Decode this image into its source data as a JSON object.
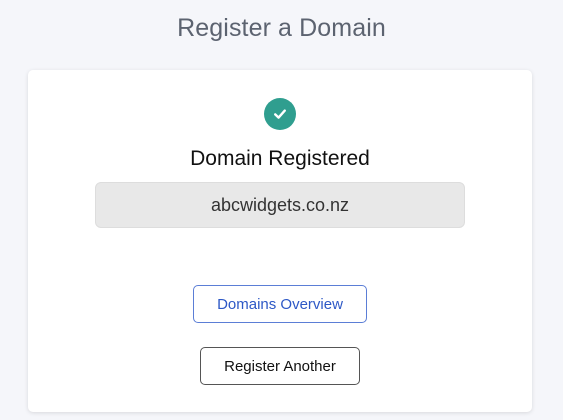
{
  "page": {
    "title": "Register a Domain"
  },
  "result": {
    "icon": "check-circle-icon",
    "icon_color": "#2f9e8f",
    "heading": "Domain Registered",
    "domain_name": "abcwidgets.co.nz"
  },
  "actions": {
    "overview_label": "Domains Overview",
    "overview_color": "#2d58c6",
    "register_another_label": "Register Another"
  }
}
